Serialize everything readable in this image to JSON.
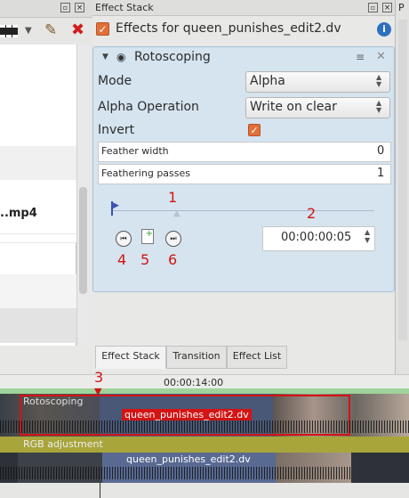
{
  "left_panel": {
    "file_label": "..mp4"
  },
  "effect_stack": {
    "panel_title": "Effect Stack",
    "header_title": "Effects for queen_punishes_edit2.dv",
    "effect": {
      "name": "Rotoscoping",
      "mode_label": "Mode",
      "mode_value": "Alpha",
      "alpha_op_label": "Alpha Operation",
      "alpha_op_value": "Write on clear",
      "invert_label": "Invert",
      "feather_width_label": "Feather width",
      "feather_width_value": "0",
      "feathering_passes_label": "Feathering passes",
      "feathering_passes_value": "1",
      "timecode": "00:00:00:05"
    }
  },
  "annotations": {
    "n1": "1",
    "n2": "2",
    "n3": "3",
    "n4": "4",
    "n5": "5",
    "n6": "6"
  },
  "tabs": {
    "effect_stack": "Effect Stack",
    "transition": "Transition",
    "effect_list": "Effect List"
  },
  "timeline": {
    "ruler_time": "00:00:14:00",
    "track1_effect": "Rotoscoping",
    "track1_clip": "queen_punishes_edit2.dv",
    "track2_effect": "RGB adjustment",
    "track2_clip": "queen_punishes_edit2.dv"
  },
  "colors": {
    "accent_red": "#d21414",
    "effect_box_bg": "#d5e4ef",
    "checkbox_orange": "#e2703a",
    "info_blue": "#2f6fc0"
  }
}
